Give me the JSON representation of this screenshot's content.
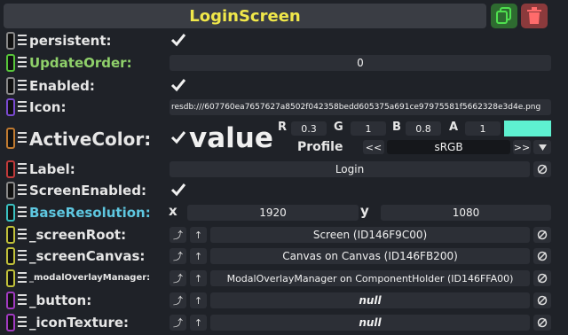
{
  "header": {
    "title": "LoginScreen",
    "duplicate_icon": "duplicate-icon",
    "delete_icon": "trash-icon"
  },
  "accent": {
    "title": "#f0e74a",
    "dup_btn": "#2e6b30",
    "del_btn": "#8b3a3c",
    "color_swatch": "#5ef0d0"
  },
  "props": {
    "persistent": {
      "label": "persistent:",
      "checked": true
    },
    "update_order": {
      "label": "UpdateOrder:",
      "value": "0"
    },
    "enabled": {
      "label": "Enabled:",
      "checked": true
    },
    "icon": {
      "label": "Icon:",
      "value": "resdb:///607760ea7657627a8502f042358bedd605375a691ce97975581f5662328e3d4e.png"
    },
    "active_color": {
      "label": "ActiveColor:",
      "checked": true,
      "value_label": "value",
      "r_label": "R",
      "r": "0.3",
      "g_label": "G",
      "g": "1",
      "b_label": "B",
      "b": "0.8",
      "a_label": "A",
      "a": "1",
      "profile_label": "Profile",
      "prev": "<<",
      "profile": "sRGB",
      "next": ">>"
    },
    "label": {
      "label": "Label:",
      "value": "Login"
    },
    "screen_enabled": {
      "label": "ScreenEnabled:",
      "checked": true
    },
    "base_resolution": {
      "label": "BaseResolution:",
      "x_label": "x",
      "x": "1920",
      "y_label": "y",
      "y": "1080"
    },
    "screen_root": {
      "label": "_screenRoot:",
      "value": "Screen (ID146F9C00)"
    },
    "screen_canvas": {
      "label": "_screenCanvas:",
      "value": "Canvas on Canvas (ID146FB200)"
    },
    "modal_overlay": {
      "label": "_modalOverlayManager:",
      "value": "ModalOverlayManager on ComponentHolder (ID146FFA00)"
    },
    "button": {
      "label": "_button:",
      "value": "null"
    },
    "icon_texture": {
      "label": "_iconTexture:",
      "value": "null"
    }
  }
}
